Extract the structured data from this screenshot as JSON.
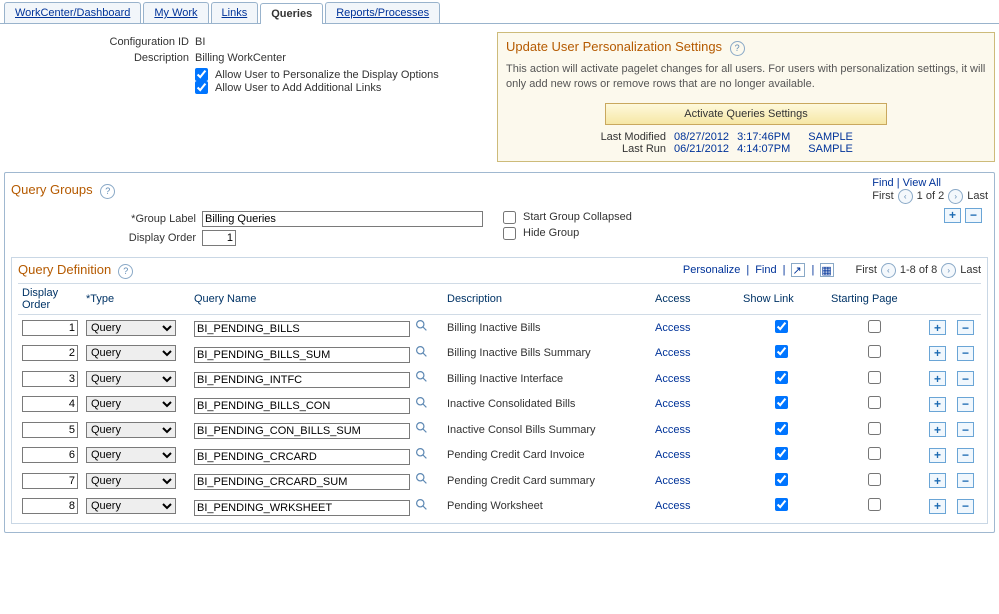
{
  "tabs": [
    "WorkCenter/Dashboard",
    "My Work",
    "Links",
    "Queries",
    "Reports/Processes"
  ],
  "activeTab": "Queries",
  "config": {
    "idLabel": "Configuration ID",
    "idValue": "BI",
    "descLabel": "Description",
    "descValue": "Billing WorkCenter",
    "opt1": "Allow User to Personalize the Display Options",
    "opt2": "Allow User to Add Additional Links"
  },
  "panel": {
    "title": "Update User Personalization Settings",
    "desc": "This action will activate pagelet changes for all users.  For users with personalization settings, it will only add new rows or remove rows that are no longer available.",
    "button": "Activate Queries Settings",
    "lastModLabel": "Last Modified",
    "lastModDate": "08/27/2012",
    "lastModTime": "3:17:46PM",
    "lastModUser": "SAMPLE",
    "lastRunLabel": "Last Run",
    "lastRunDate": "06/21/2012",
    "lastRunTime": "4:14:07PM",
    "lastRunUser": "SAMPLE"
  },
  "groups": {
    "title": "Query Groups",
    "findLabel": "Find",
    "viewAllLabel": "View All",
    "firstLabel": "First",
    "lastLabel": "Last",
    "pager": "1 of 2",
    "groupLabelLabel": "Group Label",
    "groupLabelValue": "Billing Queries",
    "displayOrderLabel": "Display Order",
    "displayOrderValue": "1",
    "startCollapsed": "Start Group Collapsed",
    "hideGroup": "Hide Group"
  },
  "defs": {
    "title": "Query Definition",
    "personalize": "Personalize",
    "find": "Find",
    "firstLabel": "First",
    "lastLabel": "Last",
    "pager": "1-8 of 8",
    "cols": {
      "disp": "Display Order",
      "type": "*Type",
      "name": "Query Name",
      "desc": "Description",
      "access": "Access",
      "showlink": "Show Link",
      "start": "Starting Page"
    },
    "typeOption": "Query",
    "accessLabel": "Access",
    "rows": [
      {
        "order": "1",
        "name": "BI_PENDING_BILLS",
        "desc": "Billing Inactive Bills"
      },
      {
        "order": "2",
        "name": "BI_PENDING_BILLS_SUM",
        "desc": "Billing Inactive Bills Summary"
      },
      {
        "order": "3",
        "name": "BI_PENDING_INTFC",
        "desc": "Billing Inactive Interface"
      },
      {
        "order": "4",
        "name": "BI_PENDING_BILLS_CON",
        "desc": "Inactive Consolidated Bills"
      },
      {
        "order": "5",
        "name": "BI_PENDING_CON_BILLS_SUM",
        "desc": "Inactive Consol Bills Summary"
      },
      {
        "order": "6",
        "name": "BI_PENDING_CRCARD",
        "desc": "Pending Credit Card Invoice"
      },
      {
        "order": "7",
        "name": "BI_PENDING_CRCARD_SUM",
        "desc": "Pending Credit Card summary"
      },
      {
        "order": "8",
        "name": "BI_PENDING_WRKSHEET",
        "desc": "Pending Worksheet"
      }
    ]
  }
}
